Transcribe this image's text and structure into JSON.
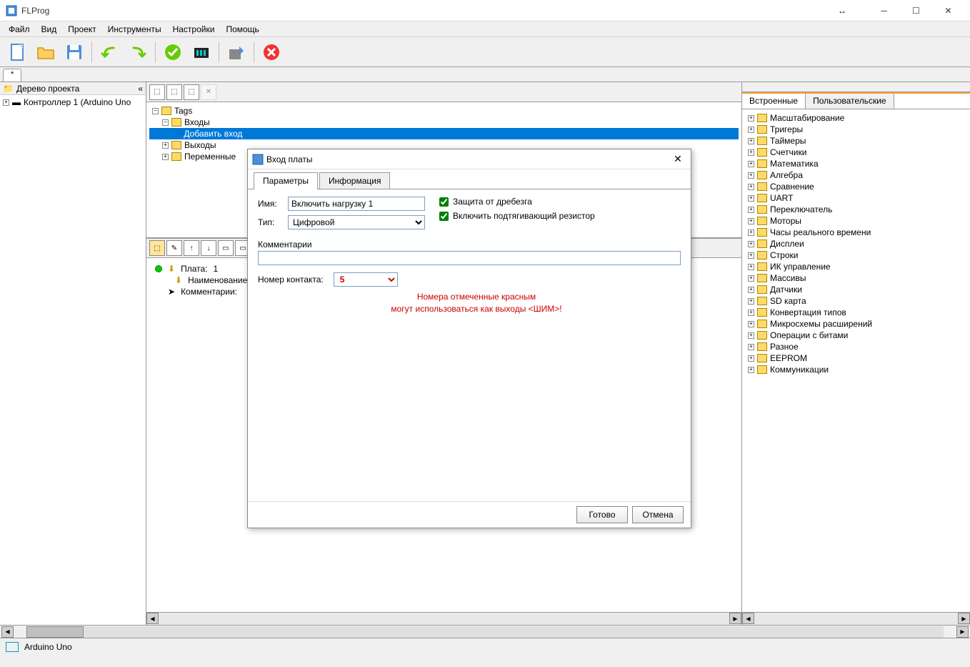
{
  "window": {
    "title": "FLProg"
  },
  "menu": {
    "file": "Файл",
    "view": "Вид",
    "project": "Проект",
    "tools": "Инструменты",
    "settings": "Настройки",
    "help": "Помощь"
  },
  "doc_tab": "*",
  "left_panel": {
    "header": "Дерево проекта",
    "controller": "Контроллер 1 (Arduino Uno"
  },
  "tags_tree": {
    "root": "Tags",
    "inputs": "Входы",
    "add_input": "Добавить вход",
    "outputs": "Выходы",
    "variables": "Переменные"
  },
  "board_info": {
    "plate_label": "Плата:",
    "plate_num": "1",
    "name_label": "Наименование:",
    "comment_label": "Комментарии:"
  },
  "right_tabs": {
    "builtin": "Встроенные",
    "user": "Пользовательские"
  },
  "library": [
    "Масштабирование",
    "Тригеры",
    "Таймеры",
    "Счетчики",
    "Математика",
    "Алгебра",
    "Сравнение",
    "UART",
    "Переключатель",
    "Моторы",
    "Часы реального времени",
    "Дисплеи",
    "Строки",
    "ИК управление",
    "Массивы",
    "Датчики",
    "SD карта",
    "Конвертация типов",
    "Микросхемы расширений",
    "Операции с битами",
    "Разное",
    "EEPROM",
    "Коммуникации"
  ],
  "statusbar": {
    "board": "Arduino Uno"
  },
  "dialog": {
    "title": "Вход платы",
    "tab_params": "Параметры",
    "tab_info": "Информация",
    "name_label": "Имя:",
    "name_value": "Включить нагрузку 1",
    "type_label": "Тип:",
    "type_value": "Цифровой",
    "debounce_label": "Защита от дребезга",
    "pullup_label": "Включить подтягивающий резистор",
    "comments_label": "Комментарии",
    "comments_value": "",
    "contact_label": "Номер контакта:",
    "contact_value": "5",
    "warning_line1": "Номера отмеченные красным",
    "warning_line2": "могут использоваться как выходы <ШИМ>!",
    "ok": "Готово",
    "cancel": "Отмена"
  }
}
